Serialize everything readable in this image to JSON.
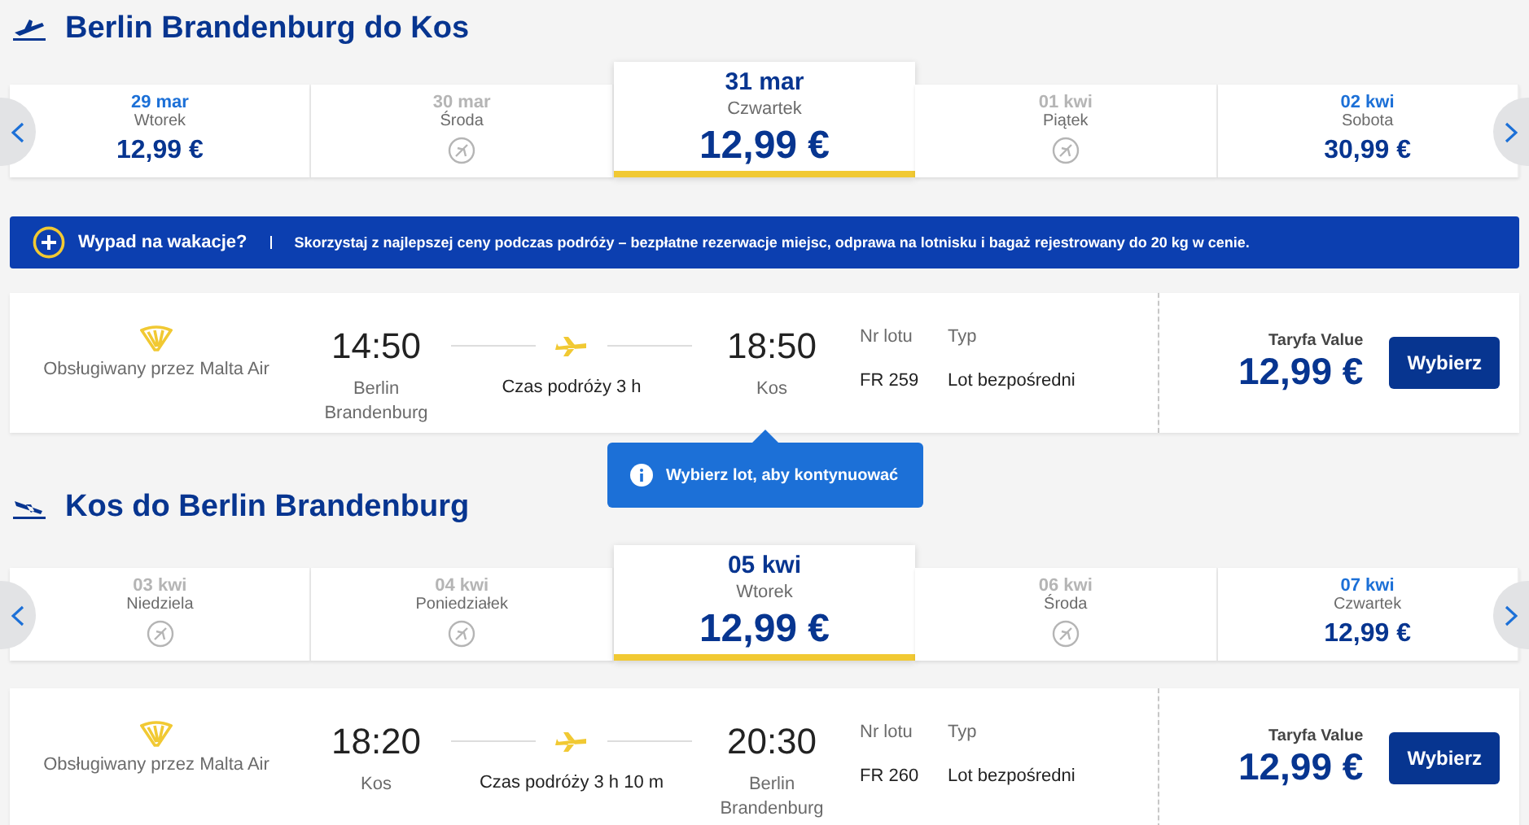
{
  "outbound": {
    "title": "Berlin Brandenburg do Kos",
    "dates": [
      {
        "date": "29 mar",
        "day": "Wtorek",
        "kind": "price",
        "price": "12,99 €",
        "selected": false
      },
      {
        "date": "30 mar",
        "day": "Środa",
        "kind": "none",
        "selected": false
      },
      {
        "date": "31 mar",
        "day": "Czwartek",
        "kind": "price",
        "price": "12,99 €",
        "selected": true
      },
      {
        "date": "01 kwi",
        "day": "Piątek",
        "kind": "none",
        "selected": false
      },
      {
        "date": "02 kwi",
        "day": "Sobota",
        "kind": "price",
        "price": "30,99 €",
        "selected": false
      }
    ],
    "flight": {
      "operator": "Obsługiwany przez Malta Air",
      "depart_time": "14:50",
      "depart_city": "Berlin Brandenburg",
      "duration": "Czas podróży 3 h",
      "arrive_time": "18:50",
      "arrive_city": "Kos",
      "flight_no_label": "Nr lotu",
      "flight_no": "FR 259",
      "type_label": "Typ",
      "type": "Lot bezpośredni",
      "fare_label": "Taryfa Value",
      "price": "12,99 €",
      "button": "Wybierz"
    }
  },
  "banner": {
    "title": "Wypad na wakacje?",
    "text": "Skorzystaj z najlepszej ceny podczas podróży – bezpłatne rezerwacje miejsc, odprawa na lotnisku i bagaż rejestrowany do 20 kg w cenie."
  },
  "tooltip": "Wybierz lot, aby kontynuować",
  "inbound": {
    "title": "Kos do Berlin Brandenburg",
    "dates": [
      {
        "date": "03 kwi",
        "day": "Niedziela",
        "kind": "none",
        "selected": false
      },
      {
        "date": "04 kwi",
        "day": "Poniedziałek",
        "kind": "none",
        "selected": false
      },
      {
        "date": "05 kwi",
        "day": "Wtorek",
        "kind": "price",
        "price": "12,99 €",
        "selected": true
      },
      {
        "date": "06 kwi",
        "day": "Środa",
        "kind": "none",
        "selected": false
      },
      {
        "date": "07 kwi",
        "day": "Czwartek",
        "kind": "price",
        "price": "12,99 €",
        "selected": false
      }
    ],
    "flight": {
      "operator": "Obsługiwany przez Malta Air",
      "depart_time": "18:20",
      "depart_city": "Kos",
      "duration": "Czas podróży 3 h 10 m",
      "arrive_time": "20:30",
      "arrive_city": "Berlin Brandenburg",
      "flight_no_label": "Nr lotu",
      "flight_no": "FR 260",
      "type_label": "Typ",
      "type": "Lot bezpośredni",
      "fare_label": "Taryfa Value",
      "price": "12,99 €",
      "button": "Wybierz"
    }
  }
}
